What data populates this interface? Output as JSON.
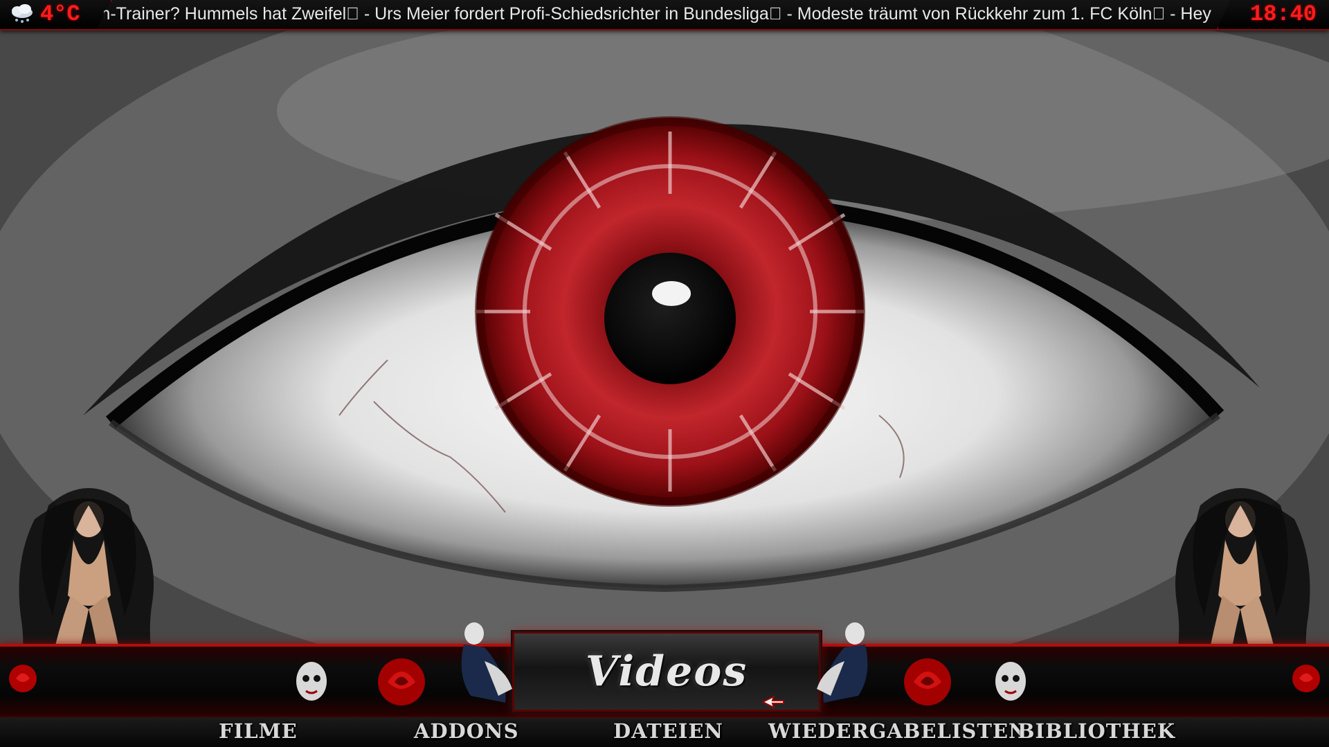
{
  "header": {
    "weather_icon": "snow-cloud-icon",
    "temperature": "4°C",
    "ticker_text": "ym-Trainer? Hummels hat Zweifel\u0000 - Urs Meier fordert Profi-Schiedsrichter in Bundesliga\u0000 - Modeste träumt von Rückkehr zum 1. FC Köln\u0000 - Hey",
    "clock": "18:40"
  },
  "section": {
    "title": "Videos"
  },
  "menu": {
    "items": [
      {
        "label": "FILME"
      },
      {
        "label": "ADDONS"
      },
      {
        "label": "DATEIEN"
      },
      {
        "label": "WIEDERGABELISTEN"
      },
      {
        "label": "BIBLIOTHEK"
      }
    ]
  },
  "colors": {
    "accent": "#b10f0f",
    "clock_red": "#ff1b1b",
    "iris_red": "#a3141a"
  }
}
